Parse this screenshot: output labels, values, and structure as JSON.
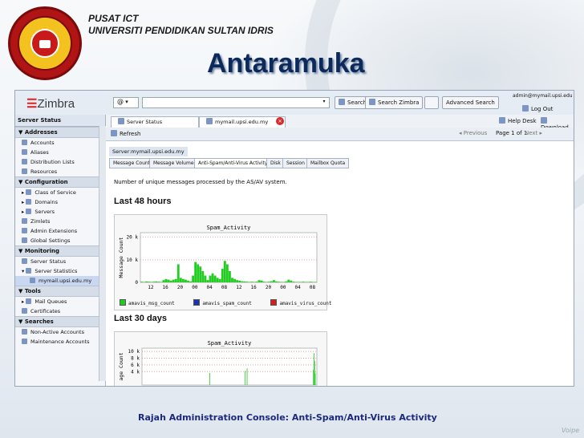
{
  "org": {
    "line1": "PUSAT ICT",
    "line2": "UNIVERSITI PENDIDIKAN SULTAN IDRIS"
  },
  "title": "Antaramuka",
  "caption": "Rajah Administration Console: Anti-Spam/Anti-Virus Activity",
  "footer_mark": "Voipe",
  "app": {
    "logo": "Zimbra",
    "search_type": "@",
    "search_btn": "Search",
    "search_zimbra_btn": "Search Zimbra",
    "advanced_search_btn": "Advanced Search",
    "user": "admin@mymail.upsi.edu",
    "logout": "Log Out",
    "help_desk": "Help Desk",
    "download": "Download",
    "tabs": [
      "Server Status",
      "mymail.upsi.edu.my"
    ],
    "refresh": "Refresh",
    "previous": "Previous",
    "page_info": "Page 1 of 1",
    "next": "Next",
    "breadcrumb": "Server:mymail.upsi.edu.my",
    "subtabs": [
      "Message Count",
      "Message Volume",
      "Anti-Spam/Anti-Virus Activity",
      "Disk",
      "Session",
      "Mailbox Quota"
    ],
    "description": "Number of unique messages processed by the AS/AV system.",
    "section_48": "Last 48 hours",
    "section_30": "Last 30 days"
  },
  "sidebar": {
    "header": "Server Status",
    "sections": [
      {
        "label": "Addresses",
        "items": [
          "Accounts",
          "Aliases",
          "Distribution Lists",
          "Resources"
        ]
      },
      {
        "label": "Configuration",
        "items": [
          "Class of Service",
          "Domains",
          "Servers",
          "Zimlets",
          "Admin Extensions",
          "Global Settings"
        ]
      },
      {
        "label": "Monitoring",
        "items": [
          "Server Status",
          "Server Statistics",
          "mymail.upsi.edu.my"
        ]
      },
      {
        "label": "Tools",
        "items": [
          "Mail Queues",
          "Certificates"
        ]
      },
      {
        "label": "Searches",
        "items": [
          "Non-Active Accounts",
          "Maintenance Accounts"
        ]
      }
    ]
  },
  "chart_data": [
    {
      "type": "bar",
      "title": "Spam_Activity",
      "ylabel": "Message Count",
      "ylim": [
        0,
        22
      ],
      "yticks": [
        "0",
        "10 k",
        "20 k"
      ],
      "xticks": [
        "12",
        "16",
        "20",
        "00",
        "04",
        "08",
        "12",
        "16",
        "20",
        "00",
        "04",
        "08"
      ],
      "series": [
        {
          "name": "amavis_msg_count",
          "color": "#22cc22",
          "values": [
            0.3,
            0.2,
            0.4,
            0.3,
            0.2,
            0.3,
            0.4,
            0.3,
            0.2,
            1.0,
            1.5,
            1.2,
            0.8,
            1.2,
            1.5,
            8.0,
            2.0,
            1.5,
            1.2,
            0.8,
            0.4,
            3.0,
            9.0,
            8.0,
            7.0,
            5.0,
            3.0,
            1.0,
            3.0,
            4.0,
            3.0,
            2.0,
            1.5,
            6.0,
            9.5,
            8.0,
            5.0,
            2.0,
            1.5,
            1.0,
            0.8,
            0.5,
            0.4,
            0.3,
            0.2,
            0.3,
            0.2,
            0.3,
            1.0,
            0.8,
            0.3,
            0.2,
            0.3,
            0.5,
            1.0,
            0.4,
            0.3,
            0.2,
            0.2,
            0.4,
            1.2,
            0.8,
            0.3,
            0.2,
            0.2,
            0.2,
            0.3,
            0.2,
            0.2,
            0.3,
            0.2,
            0.2
          ]
        },
        {
          "name": "amavis_spam_count",
          "color": "#2233aa",
          "values": []
        },
        {
          "name": "amavis_virus_count",
          "color": "#cc2222",
          "values": []
        }
      ]
    },
    {
      "type": "bar",
      "title": "Spam_Activity",
      "ylabel": "age Count",
      "ylim": [
        0,
        11
      ],
      "yticks": [
        "4 k",
        "6 k",
        "8 k",
        "10 k"
      ],
      "series": [
        {
          "name": "amavis_msg_count",
          "color": "#22cc22",
          "values": [
            0,
            0,
            0,
            0,
            0,
            0,
            0,
            0,
            0,
            0,
            0,
            0,
            0,
            0,
            0,
            0,
            0,
            0,
            0,
            0,
            0,
            0,
            0,
            0,
            0,
            0,
            0,
            0,
            0,
            0,
            0,
            0,
            0,
            0,
            0,
            0,
            0,
            0,
            0,
            0,
            0,
            0,
            0,
            0,
            0,
            0,
            0,
            0,
            0,
            0,
            0,
            0,
            0,
            0,
            0,
            0,
            0,
            0,
            0,
            0,
            0,
            0,
            0,
            0,
            0,
            0,
            0,
            0,
            0,
            0,
            0,
            0,
            0,
            0,
            0,
            0,
            0,
            0,
            0,
            0,
            0,
            0,
            0,
            0,
            0,
            0,
            0,
            0,
            0,
            0,
            0,
            0,
            0,
            0,
            0,
            0,
            0,
            0,
            0,
            0,
            0,
            0,
            0,
            0,
            0,
            0,
            0,
            3.6,
            0,
            0,
            0,
            0,
            0,
            0,
            0,
            0,
            0,
            0,
            0,
            0,
            0,
            0,
            0,
            0,
            0,
            0,
            0,
            0,
            0,
            0,
            0,
            0,
            0,
            0,
            0,
            0,
            0,
            0,
            0,
            0,
            0,
            0,
            0,
            0,
            0,
            0,
            0,
            0,
            0,
            0,
            0,
            0,
            0,
            0,
            0,
            0,
            0,
            0,
            0,
            0,
            0,
            0,
            0,
            4.2,
            0,
            0,
            5.0,
            0,
            0,
            0,
            0,
            0,
            0,
            0,
            0,
            0,
            0,
            0,
            0,
            0,
            0,
            0,
            0,
            0,
            0,
            0,
            0,
            0,
            0,
            0,
            0,
            0,
            0,
            0,
            0,
            0,
            0,
            0,
            0,
            0,
            0,
            0,
            0,
            0,
            0,
            0,
            0,
            0,
            0,
            0,
            0,
            0,
            0,
            0,
            0,
            0,
            0,
            0,
            0,
            0,
            0,
            0,
            0,
            0,
            0,
            0,
            0,
            0,
            0,
            0,
            0,
            0,
            0,
            0,
            0,
            0,
            0,
            0,
            0,
            0,
            0,
            0,
            0,
            0,
            0,
            0,
            0,
            0,
            0,
            0,
            0,
            0,
            0,
            0,
            0,
            0,
            0,
            0,
            0,
            0,
            0,
            0,
            0,
            0,
            0,
            0,
            0,
            0,
            0,
            0,
            0,
            4.6,
            9.5,
            7.2,
            3.5,
            0,
            0
          ]
        }
      ]
    }
  ]
}
